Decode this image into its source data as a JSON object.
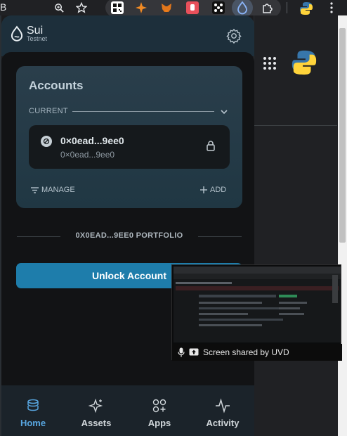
{
  "browser": {
    "left_fragment": "B",
    "icons": [
      "zoom-icon",
      "bookmark-star-icon",
      "qr-extension-icon",
      "spark-extension-icon",
      "metamask-extension-icon",
      "red-extension-icon",
      "dark-extension-icon",
      "sui-wallet-extension-icon",
      "puzzle-extension-icon",
      "python-icon",
      "more-menu-icon"
    ]
  },
  "wallet": {
    "logo_name": "Sui",
    "network": "Testnet",
    "accounts": {
      "title": "Accounts",
      "current_label": "CURRENT",
      "account_name": "0×0ead...9ee0",
      "account_address": "0×0ead...9ee0",
      "manage_label": "MANAGE",
      "add_label": "ADD"
    },
    "portfolio_label": "0X0EAD...9EE0 PORTFOLIO",
    "unlock_button": "Unlock Account",
    "nav": [
      {
        "label": "Home",
        "icon": "coins-stack-icon",
        "active": true
      },
      {
        "label": "Assets",
        "icon": "sparkle-icon",
        "active": false
      },
      {
        "label": "Apps",
        "icon": "apps-grid-icon",
        "active": false
      },
      {
        "label": "Activity",
        "icon": "activity-pulse-icon",
        "active": false
      }
    ]
  },
  "screen_share": {
    "text": "Screen shared by UVD"
  },
  "colors": {
    "accent": "#1e7dab",
    "nav_active": "#58a6e0",
    "card": "#203743"
  }
}
